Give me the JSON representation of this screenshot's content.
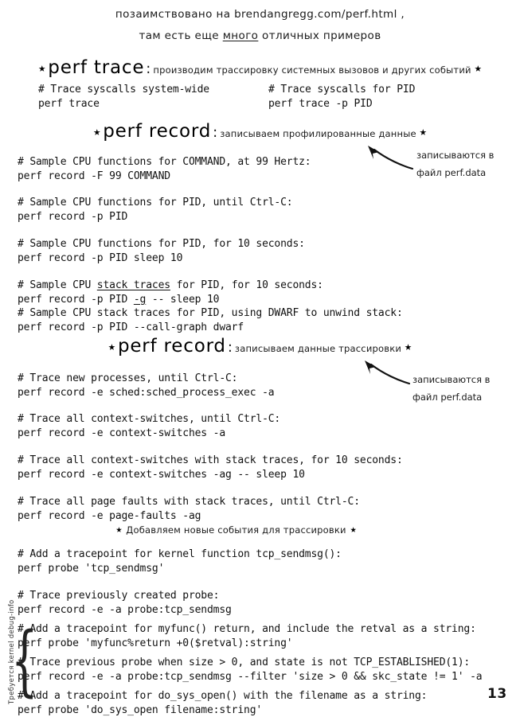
{
  "page": {
    "number": "13",
    "header_lines": [
      {
        "prefix": "позаимствовано на ",
        "link": "brendangregg.com/perf.html",
        "suffix": " ,"
      },
      {
        "before": "там есть еще ",
        "underlined": "много",
        "after": " отличных примеров"
      }
    ]
  },
  "sections": [
    {
      "id": "perf-trace",
      "command": "perf trace",
      "description": "производим трассировку системных вызовов и других событий",
      "colon": ":",
      "star": "★"
    },
    {
      "id": "perf-record-profiling",
      "command": "perf record",
      "description": "записываем профилированные данные",
      "colon": ":",
      "star": "★"
    },
    {
      "id": "perf-record-tracing",
      "command": "perf record",
      "description": "записываем данные трассировки",
      "colon": ":",
      "star": "★"
    }
  ],
  "subsection": {
    "id": "add-new-events",
    "description": "Добавляем новые события для трассировки",
    "star": "★"
  },
  "annotations": [
    {
      "id": "annot-profiling",
      "text": "записываются в\nфайл perf.data"
    },
    {
      "id": "annot-tracing",
      "text": "записываются в\nфайл perf.data"
    }
  ],
  "margin_note": "Требуется kernel debug-info",
  "code_blocks": {
    "trace_left": "# Trace syscalls system-wide\nperf trace",
    "trace_right": "# Trace syscalls for PID\nperf trace -p PID",
    "record_1": "# Sample CPU functions for COMMAND, at 99 Hertz:\nperf record -F 99 COMMAND",
    "record_2": "# Sample CPU functions for PID, until Ctrl-C:\nperf record -p PID",
    "record_3": "# Sample CPU functions for PID, for 10 seconds:\nperf record -p PID sleep 10",
    "record_4_comment_a": "# Sample CPU ",
    "record_4_comment_u": "stack traces",
    "record_4_comment_b": " for PID, for 10 seconds:",
    "record_4_cmd_a": "perf record -p PID ",
    "record_4_cmd_u": "-g",
    "record_4_cmd_b": " -- sleep 10",
    "record_5": "# Sample CPU stack traces for PID, using DWARF to unwind stack:\nperf record -p PID --call-graph dwarf",
    "trace_1": "# Trace new processes, until Ctrl-C:\nperf record -e sched:sched_process_exec -a",
    "trace_2": "# Trace all context-switches, until Ctrl-C:\nperf record -e context-switches -a",
    "trace_3": "# Trace all context-switches with stack traces, for 10 seconds:\nperf record -e context-switches -ag -- sleep 10",
    "trace_4": "# Trace all page faults with stack traces, until Ctrl-C:\nperf record -e page-faults -ag",
    "probe_1": "# Add a tracepoint for kernel function tcp_sendmsg():\nperf probe 'tcp_sendmsg'",
    "probe_2": "# Trace previously created probe:\nperf record -e -a probe:tcp_sendmsg",
    "probe_3": "# Add a tracepoint for myfunc() return, and include the retval as a string:\nperf probe 'myfunc%return +0($retval):string'",
    "probe_4": "# Trace previous probe when size > 0, and state is not TCP_ESTABLISHED(1):\nperf record -e -a probe:tcp_sendmsg --filter 'size > 0 && skc_state != 1' -a",
    "probe_5": "# Add a tracepoint for do_sys_open() with the filename as a string:\nperf probe 'do_sys_open filename:string'"
  }
}
